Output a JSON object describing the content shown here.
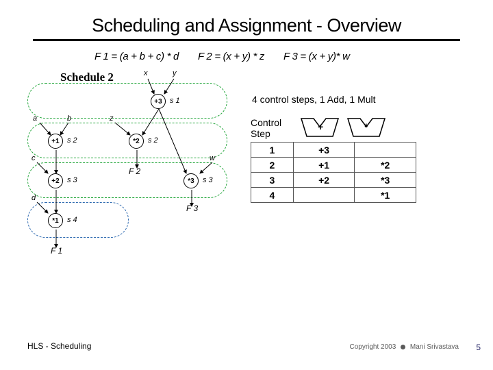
{
  "title": "Scheduling and Assignment - Overview",
  "equations": {
    "f1": "F 1 = (a + b + c) * d",
    "f2": "F 2 = (x + y) * z",
    "f3": "F 3 = (x + y)* w"
  },
  "schedule_label": "Schedule 2",
  "summary": "4 control steps, 1 Add, 1 Mult",
  "table_header_label": "Control\nStep",
  "fu": {
    "add": "+",
    "mult": "*"
  },
  "chart_data": {
    "type": "table",
    "title": "Schedule 2 operation assignment",
    "categories": [
      "1",
      "2",
      "3",
      "4"
    ],
    "series": [
      {
        "name": "+",
        "values": [
          "+3",
          "+1",
          "+2",
          ""
        ]
      },
      {
        "name": "*",
        "values": [
          "",
          "*2",
          "*3",
          "*1"
        ]
      }
    ]
  },
  "diagram": {
    "inputs": {
      "a": "a",
      "b": "b",
      "c": "c",
      "d": "d",
      "x": "x",
      "y": "y",
      "z": "z",
      "w": "w"
    },
    "nodes": {
      "p1": "+1",
      "p2": "+2",
      "p3": "+3",
      "m1": "*1",
      "m2": "*2",
      "m3": "*3"
    },
    "steps": {
      "s1": "s 1",
      "s2": "s 2",
      "s3": "s 3",
      "s4": "s 4"
    },
    "outputs": {
      "F1": "F 1",
      "F2": "F 2",
      "F3": "F 3"
    }
  },
  "footer": {
    "left": "HLS - Scheduling",
    "right_pre": "Copyright 2003",
    "right_post": "Mani Srivastava",
    "num": "5"
  }
}
